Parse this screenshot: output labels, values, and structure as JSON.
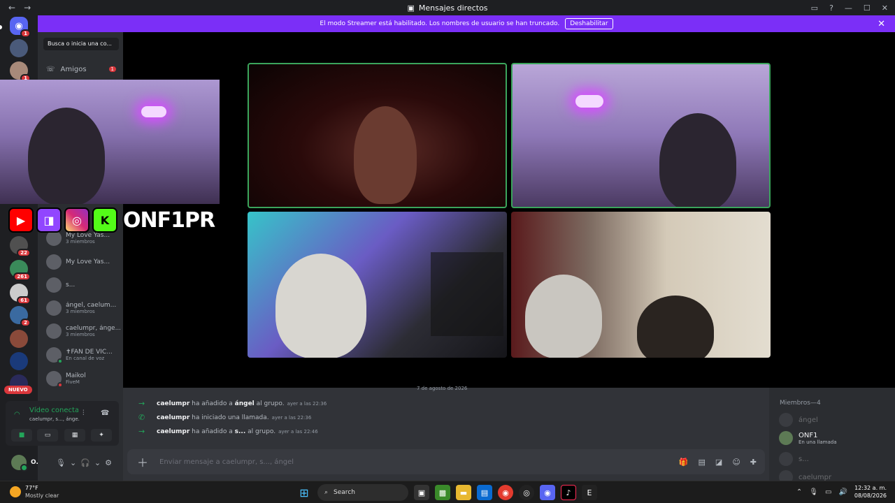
{
  "window": {
    "title": "Mensajes directos"
  },
  "banner": {
    "text": "El modo Streamer está habilitado. Los nombres de usuario se han truncado.",
    "button": "Deshabilitar"
  },
  "sidebar": {
    "search_placeholder": "Busca o inicia una co...",
    "friends_label": "Amigos",
    "friends_badge": "1",
    "server_badges": [
      "1",
      "1",
      "22",
      "261",
      "61",
      "2"
    ],
    "new_label": "NUEVO",
    "dms": [
      {
        "name": "My Love Yas...",
        "sub": "3 miembros"
      },
      {
        "name": "My Love Yas...",
        "sub": ""
      },
      {
        "name": "s...",
        "sub": ""
      },
      {
        "name": "ángel, caelum...",
        "sub": "3 miembros"
      },
      {
        "name": "caelumpr, ánge...",
        "sub": "3 miembros"
      },
      {
        "name": "✝FAN DE VIC...",
        "sub": "En canal de voz"
      },
      {
        "name": "Maikol",
        "sub": "FiveM"
      }
    ]
  },
  "voice": {
    "status": "Vídeo conectado",
    "channel": "caelumpr, s..., ánge..."
  },
  "user": {
    "name": "O."
  },
  "overlay": {
    "handle": "ONF1PR"
  },
  "chat": {
    "date_divider": "7 de agosto de 2026",
    "messages": [
      {
        "icon": "arrow",
        "user": "caelumpr",
        "action_pre": "ha añadido a",
        "target": "ángel",
        "action_post": "al grupo.",
        "time": "ayer a las 22:36"
      },
      {
        "icon": "phone",
        "user": "caelumpr",
        "action_pre": "ha iniciado una llamada.",
        "target": "",
        "action_post": "",
        "time": "ayer a las 22:36"
      },
      {
        "icon": "arrow",
        "user": "caelumpr",
        "action_pre": "ha añadido a",
        "target": "s...",
        "action_post": "al grupo.",
        "time": "ayer a las 22:46"
      }
    ],
    "input_placeholder": "Enviar mensaje a caelumpr, s..., ángel"
  },
  "members": {
    "header": "Miembros—4",
    "list": [
      {
        "name": "ángel",
        "sub": ""
      },
      {
        "name": "ONF1",
        "sub": "En una llamada"
      },
      {
        "name": "s...",
        "sub": ""
      },
      {
        "name": "caelumpr",
        "sub": ""
      }
    ]
  },
  "taskbar": {
    "temp": "77°F",
    "condition": "Mostly clear",
    "search": "Search",
    "time": "12:32 a. m.",
    "date": "08/08/2026"
  },
  "colors": {
    "accent": "#5865f2",
    "streamer_banner": "#7b2ff7",
    "online": "#23a55a",
    "badge": "#da373c"
  }
}
